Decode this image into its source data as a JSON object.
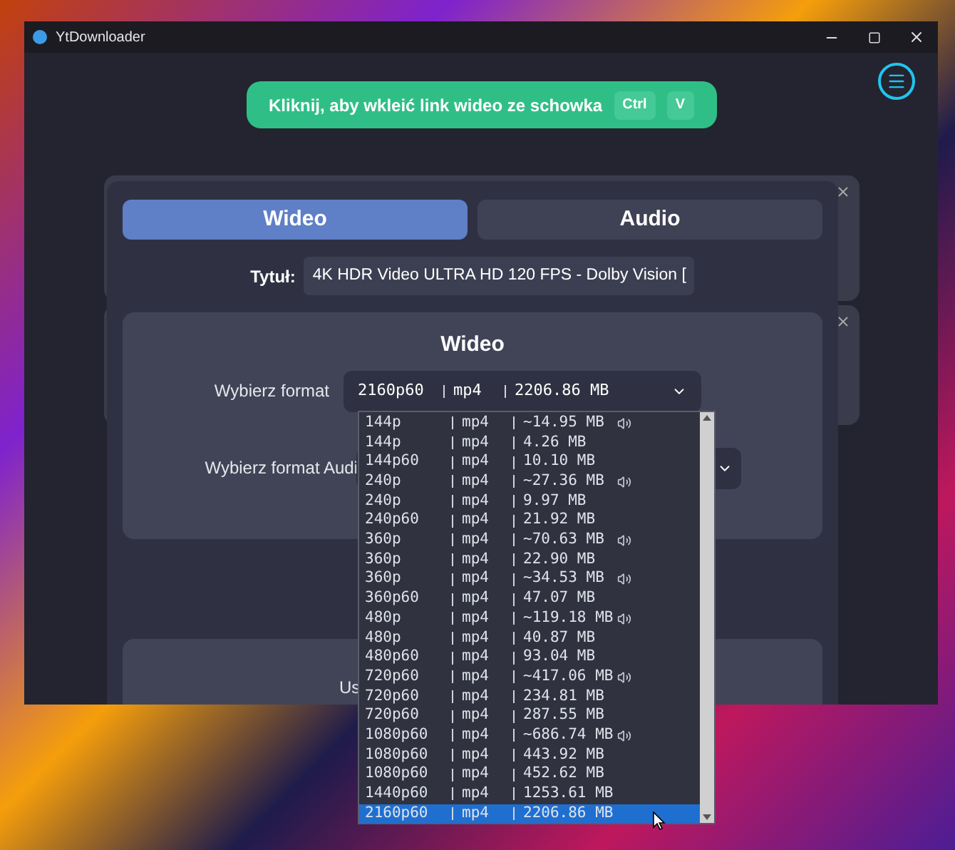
{
  "window": {
    "title": "YtDownloader"
  },
  "paste_button": {
    "label": "Kliknij, aby wkleić link wideo ze schowka",
    "keys": [
      "Ctrl",
      "V"
    ]
  },
  "tabs": [
    {
      "label": "Wideo",
      "selected": true
    },
    {
      "label": "Audio",
      "selected": false
    }
  ],
  "title_field": {
    "label": "Tytuł:",
    "value": "4K HDR Video ULTRA HD 120 FPS - Dolby Vision ["
  },
  "video_section": {
    "heading": "Wideo",
    "format_label": "Wybierz format",
    "format_value": {
      "format": "2160p60",
      "ext": "mp4",
      "size": "2206.86 MB"
    },
    "audio_label": "Wybierz format Audi"
  },
  "second_section": {
    "label": "Us"
  },
  "format_list": [
    {
      "format": "144p",
      "ext": "mp4",
      "size": "~14.95 MB",
      "audio": true,
      "selected": false
    },
    {
      "format": "144p",
      "ext": "mp4",
      "size": "4.26 MB",
      "audio": false,
      "selected": false
    },
    {
      "format": "144p60",
      "ext": "mp4",
      "size": "10.10 MB",
      "audio": false,
      "selected": false
    },
    {
      "format": "240p",
      "ext": "mp4",
      "size": "~27.36 MB",
      "audio": true,
      "selected": false
    },
    {
      "format": "240p",
      "ext": "mp4",
      "size": "9.97 MB",
      "audio": false,
      "selected": false
    },
    {
      "format": "240p60",
      "ext": "mp4",
      "size": "21.92 MB",
      "audio": false,
      "selected": false
    },
    {
      "format": "360p",
      "ext": "mp4",
      "size": "~70.63 MB",
      "audio": true,
      "selected": false
    },
    {
      "format": "360p",
      "ext": "mp4",
      "size": "22.90 MB",
      "audio": false,
      "selected": false
    },
    {
      "format": "360p",
      "ext": "mp4",
      "size": "~34.53 MB",
      "audio": true,
      "selected": false
    },
    {
      "format": "360p60",
      "ext": "mp4",
      "size": "47.07 MB",
      "audio": false,
      "selected": false
    },
    {
      "format": "480p",
      "ext": "mp4",
      "size": "~119.18 MB",
      "audio": true,
      "selected": false
    },
    {
      "format": "480p",
      "ext": "mp4",
      "size": "40.87 MB",
      "audio": false,
      "selected": false
    },
    {
      "format": "480p60",
      "ext": "mp4",
      "size": "93.04 MB",
      "audio": false,
      "selected": false
    },
    {
      "format": "720p60",
      "ext": "mp4",
      "size": "~417.06 MB",
      "audio": true,
      "selected": false
    },
    {
      "format": "720p60",
      "ext": "mp4",
      "size": "234.81 MB",
      "audio": false,
      "selected": false
    },
    {
      "format": "720p60",
      "ext": "mp4",
      "size": "287.55 MB",
      "audio": false,
      "selected": false
    },
    {
      "format": "1080p60",
      "ext": "mp4",
      "size": "~686.74 MB",
      "audio": true,
      "selected": false
    },
    {
      "format": "1080p60",
      "ext": "mp4",
      "size": "443.92 MB",
      "audio": false,
      "selected": false
    },
    {
      "format": "1080p60",
      "ext": "mp4",
      "size": "452.62 MB",
      "audio": false,
      "selected": false
    },
    {
      "format": "1440p60",
      "ext": "mp4",
      "size": "1253.61 MB",
      "audio": false,
      "selected": false
    },
    {
      "format": "2160p60",
      "ext": "mp4",
      "size": "2206.86 MB",
      "audio": false,
      "selected": true
    }
  ]
}
